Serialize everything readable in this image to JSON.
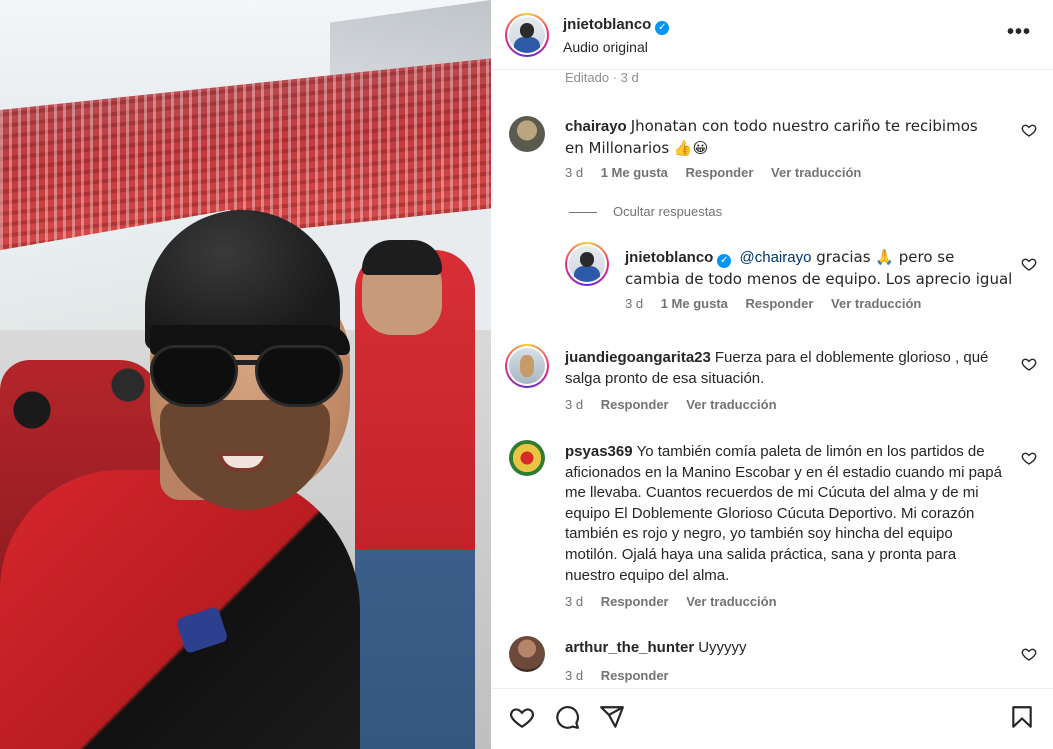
{
  "post": {
    "owner": "jnietoblanco",
    "audio": "Audio original",
    "edited": "Editado · 3 d"
  },
  "icons": {
    "more": "more-options-icon",
    "verified": "verified-badge-icon",
    "heart": "heart-icon",
    "comment": "comment-icon",
    "share": "share-icon",
    "save": "bookmark-icon"
  },
  "colors": {
    "link": "#00376b",
    "verified": "#0095f6",
    "muted": "#737373"
  },
  "comments": [
    {
      "user": "chairayo",
      "text": "Jhonatan con todo nuestro cariño te recibimos en Millonarios 👍😀",
      "time": "3 d",
      "likes": "1 Me gusta",
      "reply": "Responder",
      "translate": "Ver traducción",
      "hide_replies": "Ocultar respuestas",
      "replies": [
        {
          "user": "jnietoblanco",
          "mention": "@chairayo",
          "text": " gracias 🙏 pero se cambia de todo menos de equipo. Los aprecio igual",
          "time": "3 d",
          "likes": "1 Me gusta",
          "reply": "Responder",
          "translate": "Ver traducción"
        }
      ]
    },
    {
      "user": "juandiegoangarita23",
      "text": "Fuerza para el doblemente glorioso , qué salga pronto de esa situación.",
      "time": "3 d",
      "reply": "Responder",
      "translate": "Ver traducción"
    },
    {
      "user": "psyas369",
      "text": "Yo también comía paleta de limón en los partidos de aficionados en la Manino Escobar y en él estadio cuando mi papá me llevaba. Cuantos recuerdos de mi Cúcuta del alma y de mi equipo El Doblemente Glorioso Cúcuta Deportivo. Mi corazón también es rojo y negro, yo también soy hincha del equipo motilón. Ojalá haya una salida práctica, sana y pronta para nuestro equipo del alma.",
      "time": "3 d",
      "reply": "Responder",
      "translate": "Ver traducción"
    },
    {
      "user": "arthur_the_hunter",
      "text": "Uyyyyy",
      "time": "3 d",
      "reply": "Responder"
    }
  ]
}
